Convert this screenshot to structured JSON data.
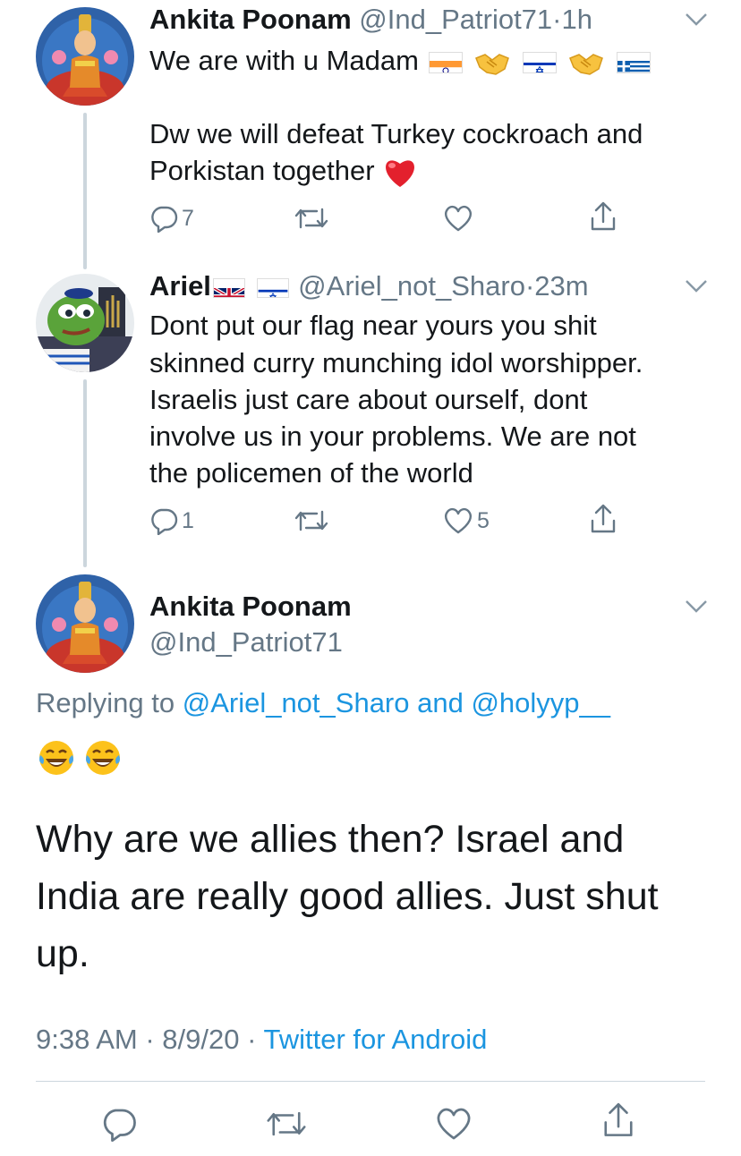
{
  "tweets": [
    {
      "name": "Ankita Poonam",
      "handle": "@Ind_Patriot71",
      "time": "1h",
      "line1": "We are with u Madam",
      "line2": "Dw we will defeat Turkey cockroach and",
      "line3": "Porkistan together",
      "reply_count": "7",
      "like_count": ""
    },
    {
      "name": "Ariel",
      "handle": "@Ariel_not_Sharo",
      "time": "23m",
      "lines": [
        "Dont put our flag near yours you shit",
        "skinned curry munching idol worshipper.",
        "Israelis just care about ourself, dont",
        "involve us in your problems. We are not",
        "the policemen of the world"
      ],
      "reply_count": "1",
      "like_count": "5"
    }
  ],
  "main_tweet": {
    "name": "Ankita Poonam",
    "handle": "@Ind_Patriot71",
    "replying_prefix": "Replying to",
    "replying_users": "@Ariel_not_Sharo and @holyyp__",
    "lines": [
      "Why are we allies then? Israel and",
      "India are really good allies. Just shut",
      "up."
    ],
    "timestamp": "9:38 AM · 8/9/20 ·",
    "source": "Twitter for Android"
  },
  "dot": "·",
  "colors": {
    "accent": "#1b95e0",
    "secondary_text": "#657786",
    "heart": "#e0245e"
  }
}
